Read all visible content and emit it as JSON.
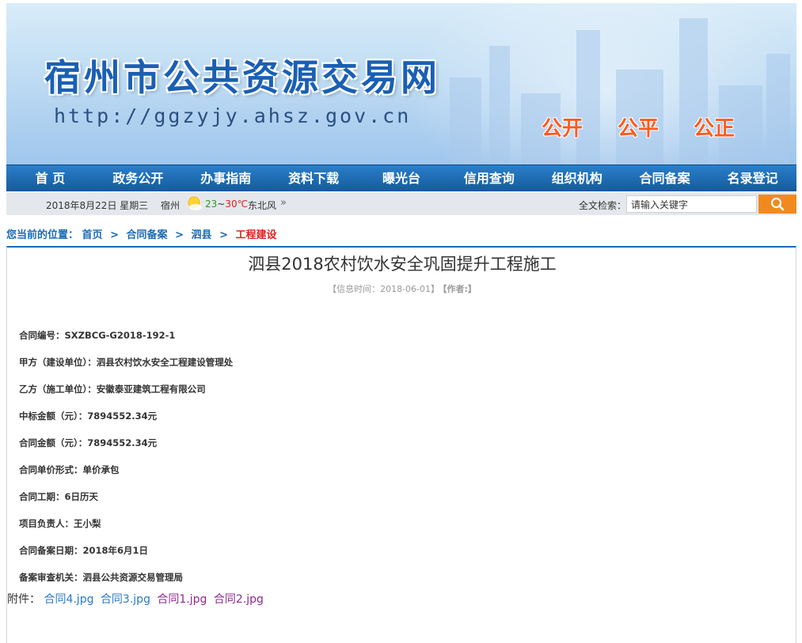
{
  "banner": {
    "title": "宿州市公共资源交易网",
    "url": "http://ggzyjy.ahsz.gov.cn",
    "slogans": [
      "公开",
      "公平",
      "公正"
    ]
  },
  "nav": [
    "首 页",
    "政务公开",
    "办事指南",
    "资料下载",
    "曝光台",
    "信用查询",
    "组织机构",
    "合同备案",
    "名录登记"
  ],
  "infobar": {
    "date": "2018年8月22日 星期三",
    "city": "宿州",
    "temp_low": "23",
    "temp_sep": "~",
    "temp_high": "30℃",
    "wind": "东北风",
    "more": "»",
    "search_label": "全文检索：",
    "search_value": "请输入关键字"
  },
  "breadcrumb": {
    "label": "您当前的位置：",
    "items": [
      "首页",
      "合同备案",
      "泗县"
    ],
    "current": "工程建设",
    "sep": ">"
  },
  "article": {
    "title": "泗县2018农村饮水安全巩固提升工程施工",
    "meta_time": "【信息时间：2018-06-01】",
    "meta_author": "【作者:】",
    "fields": [
      "合同编号：SXZBCG-G2018-192-1",
      "甲方（建设单位）：泗县农村饮水安全工程建设管理处",
      "乙方（施工单位）：安徽泰亚建筑工程有限公司",
      "中标金额（元）：7894552.34元",
      "合同金额（元）：7894552.34元",
      "合同单价形式：单价承包",
      "合同工期：6日历天",
      "项目负责人：王小梨",
      "合同备案日期：2018年6月1日",
      "备案审查机关：泗县公共资源交易管理局"
    ],
    "attach_label": "附件：",
    "attachments": [
      "合同4.jpg",
      "合同3.jpg",
      "合同1.jpg",
      "合同2.jpg"
    ]
  }
}
